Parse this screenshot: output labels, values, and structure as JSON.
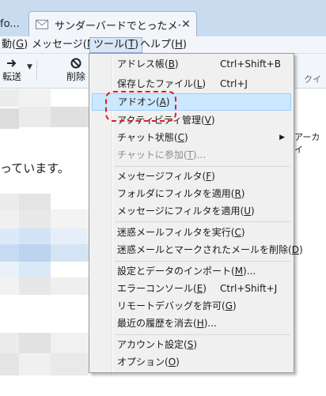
{
  "tabs": {
    "previous_label": "fo...",
    "active_title": "サンダーバードでとったメール ...",
    "close_glyph": "✕"
  },
  "menubar": {
    "go": {
      "label": "動",
      "key": "G",
      "close": ")"
    },
    "message": {
      "label": "メッセージ(",
      "key": "M",
      "close": ")"
    },
    "tools": {
      "label": "ツール(",
      "key": "T",
      "close": ")"
    },
    "help": {
      "label": "ヘルプ(",
      "key": "H",
      "close": ")"
    }
  },
  "toolbar": {
    "forward_label": "転送",
    "delete_label": "削除",
    "quick_filter_label": "クイッ",
    "archive_label": "アーカイ"
  },
  "message": {
    "body_text": "っています。"
  },
  "tools_menu": {
    "items": [
      {
        "label": "アドレス帳(",
        "key": "B",
        "close": ")",
        "shortcut": "Ctrl+Shift+B"
      },
      {
        "label": "保存したファイル(",
        "key": "L",
        "close": ")",
        "shortcut": "Ctrl+J"
      },
      {
        "label": "アドオン(",
        "key": "A",
        "close": ")",
        "shortcut": ""
      },
      {
        "label": "アクティビティ管理(",
        "key": "V",
        "close": ")",
        "shortcut": ""
      },
      {
        "label": "チャット状態(",
        "key": "C",
        "close": ")",
        "shortcut": ""
      },
      {
        "label": "チャットに参加(",
        "key": "T",
        "close": ")...",
        "shortcut": ""
      },
      {
        "label": "メッセージフィルタ(",
        "key": "F",
        "close": ")",
        "shortcut": ""
      },
      {
        "label": "フォルダにフィルタを適用(",
        "key": "R",
        "close": ")",
        "shortcut": ""
      },
      {
        "label": "メッセージにフィルタを適用(",
        "key": "U",
        "close": ")",
        "shortcut": ""
      },
      {
        "label": "迷惑メールフィルタを実行(",
        "key": "C",
        "close": ")",
        "shortcut": ""
      },
      {
        "label": "迷惑メールとマークされたメールを削除(",
        "key": "D",
        "close": ")",
        "shortcut": ""
      },
      {
        "label": "設定とデータのインポート(",
        "key": "M",
        "close": ")...",
        "shortcut": ""
      },
      {
        "label": "エラーコンソール(",
        "key": "E",
        "close": ")",
        "shortcut": "Ctrl+Shift+J"
      },
      {
        "label": "リモートデバッグを許可(",
        "key": "G",
        "close": ")",
        "shortcut": ""
      },
      {
        "label": "最近の履歴を消去(",
        "key": "H",
        "close": ")...",
        "shortcut": ""
      },
      {
        "label": "アカウント設定(",
        "key": "S",
        "close": ")",
        "shortcut": ""
      },
      {
        "label": "オプション(",
        "key": "O",
        "close": ")",
        "shortcut": ""
      }
    ],
    "highlighted_item": "アドオン",
    "submenu_arrow": "▶"
  },
  "colors": {
    "tab_strip": "#c9dcef",
    "toolbar_bg": "#f2f6fa",
    "menu_bg": "#f0f0f0",
    "highlight_bg": "#cce8ff",
    "highlight_border": "#99d1ff",
    "callout": "#e0201b",
    "disabled_text": "#8d8d8d"
  },
  "icons": [
    "mail-icon",
    "close-icon",
    "forward-arrow-icon",
    "dropdown-arrow-icon",
    "delete-icon",
    "submenu-arrow-icon"
  ]
}
